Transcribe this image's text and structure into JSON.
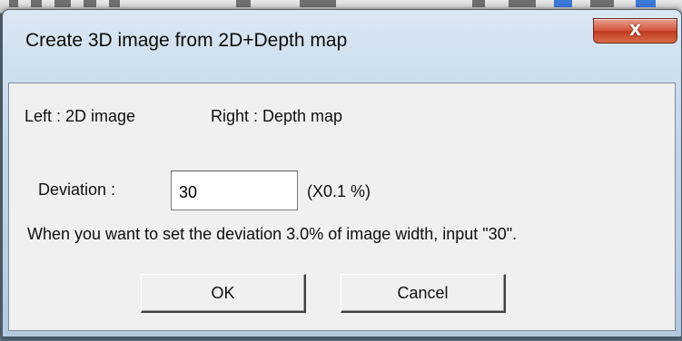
{
  "window": {
    "title": "Create 3D image from 2D+Depth map",
    "close_symbol": "X"
  },
  "dialog": {
    "left_label": "Left : 2D image",
    "right_label": "Right : Depth map",
    "deviation_label": "Deviation :",
    "deviation_value": "30",
    "deviation_unit": "(X0.1 %)",
    "hint": "When you want to set the deviation 3.0% of image width, input \"30\"."
  },
  "buttons": {
    "ok": "OK",
    "cancel": "Cancel"
  },
  "icons": {
    "close": "close-icon"
  }
}
